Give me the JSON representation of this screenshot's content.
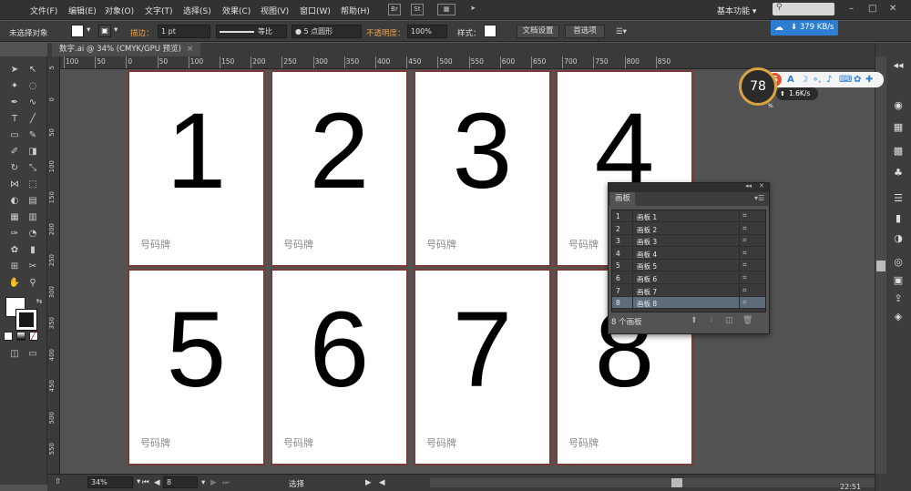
{
  "menubar": {
    "items": [
      "文件(F)",
      "编辑(E)",
      "对象(O)",
      "文字(T)",
      "选择(S)",
      "效果(C)",
      "视图(V)",
      "窗口(W)",
      "帮助(H)"
    ],
    "bridge_label": "Br",
    "stock_label": "St",
    "workspace": "基本功能",
    "window_controls": [
      "–",
      "□",
      "✕"
    ]
  },
  "control_bar": {
    "selection": "未选择对象",
    "stroke_label": "描边：",
    "stroke_weight": "1 pt",
    "stroke_profile": "等比",
    "brush": "● 5 点圆形",
    "opacity_label": "不透明度：",
    "opacity_value": "100%",
    "style_label": "样式：",
    "doc_setup": "文档设置",
    "prefs": "首选项"
  },
  "document_tab": {
    "title": "数字.ai @ 34% (CMYK/GPU 预览)",
    "close": "×"
  },
  "ruler": {
    "top_labels": [
      "100",
      "50",
      "0",
      "50",
      "100",
      "150",
      "200",
      "250",
      "300",
      "350",
      "400",
      "450",
      "500",
      "550",
      "600",
      "650",
      "700",
      "750",
      "800",
      "850"
    ],
    "left_labels": [
      "5",
      "0",
      "50",
      "100",
      "150",
      "200",
      "250",
      "300",
      "350",
      "400",
      "450",
      "500",
      "550"
    ]
  },
  "artboards": [
    {
      "number": "1",
      "label": "号码牌"
    },
    {
      "number": "2",
      "label": "号码牌"
    },
    {
      "number": "3",
      "label": "号码牌"
    },
    {
      "number": "4",
      "label": "号码牌"
    },
    {
      "number": "5",
      "label": "号码牌"
    },
    {
      "number": "6",
      "label": "号码牌"
    },
    {
      "number": "7",
      "label": "号码牌"
    },
    {
      "number": "8",
      "label": "号码牌"
    }
  ],
  "artboard_panel": {
    "tab": "画板",
    "rows": [
      {
        "num": "1",
        "name": "画板 1"
      },
      {
        "num": "2",
        "name": "画板 2"
      },
      {
        "num": "3",
        "name": "画板 3"
      },
      {
        "num": "4",
        "name": "画板 4"
      },
      {
        "num": "5",
        "name": "画板 5"
      },
      {
        "num": "6",
        "name": "画板 6"
      },
      {
        "num": "7",
        "name": "画板 7"
      },
      {
        "num": "8",
        "name": "画板 8"
      }
    ],
    "selected_index": 7,
    "count_label": "8 个画板"
  },
  "status_bar": {
    "zoom": "34%",
    "artboard_nav": "8",
    "tool": "选择"
  },
  "overlays": {
    "net_speed_badge": "379 KB/s",
    "perf_value": "78",
    "perf_unit": "%",
    "net_speed_small": "1.6K/s",
    "ime_logo": "S",
    "ime_mode": "A",
    "clock": "22:51"
  },
  "colors": {
    "artboard_border": "#7a3b36",
    "panel_selection": "#5d6b7a",
    "speed_badge": "#2d7dd2",
    "ime_logo": "#e8502e"
  }
}
